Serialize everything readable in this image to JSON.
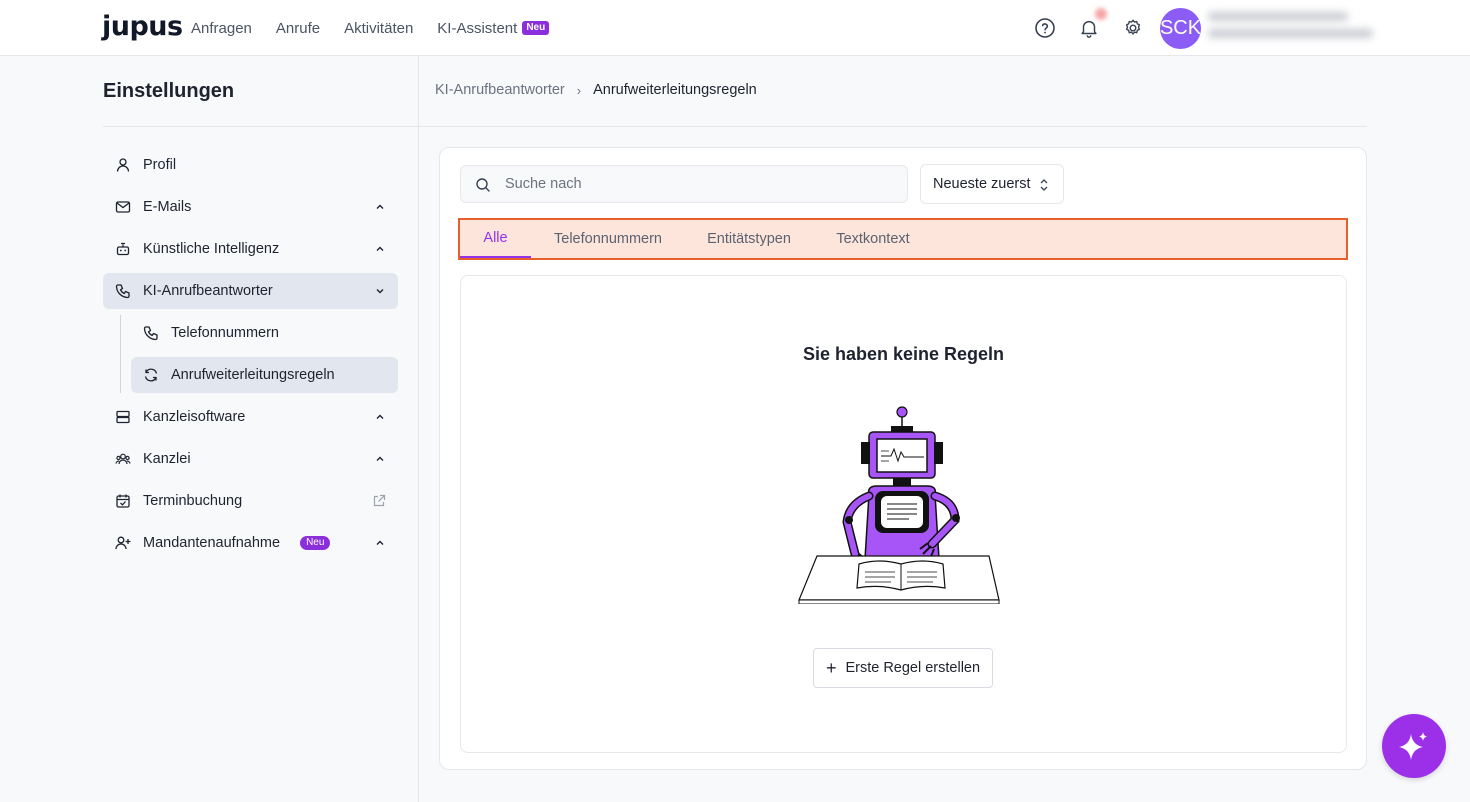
{
  "app": {
    "logo": "jupus"
  },
  "nav": {
    "items": [
      {
        "label": "Anfragen"
      },
      {
        "label": "Anrufe"
      },
      {
        "label": "Aktivitäten"
      },
      {
        "label": "KI-Assistent",
        "badge": "Neu"
      }
    ]
  },
  "header": {
    "icons": [
      "help-icon",
      "bell-icon",
      "gear-icon"
    ],
    "avatar_initials": "SCK"
  },
  "sidebar": {
    "title": "Einstellungen",
    "items": [
      {
        "label": "Profil",
        "icon": "user-icon"
      },
      {
        "label": "E-Mails",
        "icon": "mail-icon",
        "expand": "chevron-up"
      },
      {
        "label": "Künstliche Intelligenz",
        "icon": "robot-icon",
        "expand": "chevron-up"
      },
      {
        "label": "KI-Anrufbeantworter",
        "icon": "phone-icon",
        "expand": "chevron-down",
        "active": true
      },
      {
        "label": "Telefonnummern",
        "icon": "phone-icon"
      },
      {
        "label": "Anrufweiterleitungsregeln",
        "icon": "refresh-icon",
        "active": true
      },
      {
        "label": "Kanzleisoftware",
        "icon": "server-icon",
        "expand": "chevron-up"
      },
      {
        "label": "Kanzlei",
        "icon": "users-icon",
        "expand": "chevron-up"
      },
      {
        "label": "Terminbuchung",
        "icon": "calendar-check-icon",
        "external": true
      },
      {
        "label": "Mandantenaufnahme",
        "icon": "user-plus-icon",
        "badge": "Neu",
        "expand": "chevron-up"
      }
    ]
  },
  "breadcrumb": {
    "parent": "KI-Anrufbeantworter",
    "current": "Anrufweiterleitungsregeln"
  },
  "search": {
    "placeholder": "Suche nach",
    "value": ""
  },
  "sort": {
    "selected": "Neueste zuerst"
  },
  "tabs": [
    {
      "label": "Alle",
      "active": true
    },
    {
      "label": "Telefonnummern"
    },
    {
      "label": "Entitätstypen"
    },
    {
      "label": "Textkontext"
    }
  ],
  "empty_state": {
    "title": "Sie haben keine Regeln",
    "button_label": "Erste Regel erstellen"
  },
  "colors": {
    "accent": "#9333ea",
    "tab_highlight_bg": "#fde5dc",
    "tab_highlight_border": "#e5602a",
    "avatar": "#8b5cf6",
    "fab": "#9b30e8"
  }
}
